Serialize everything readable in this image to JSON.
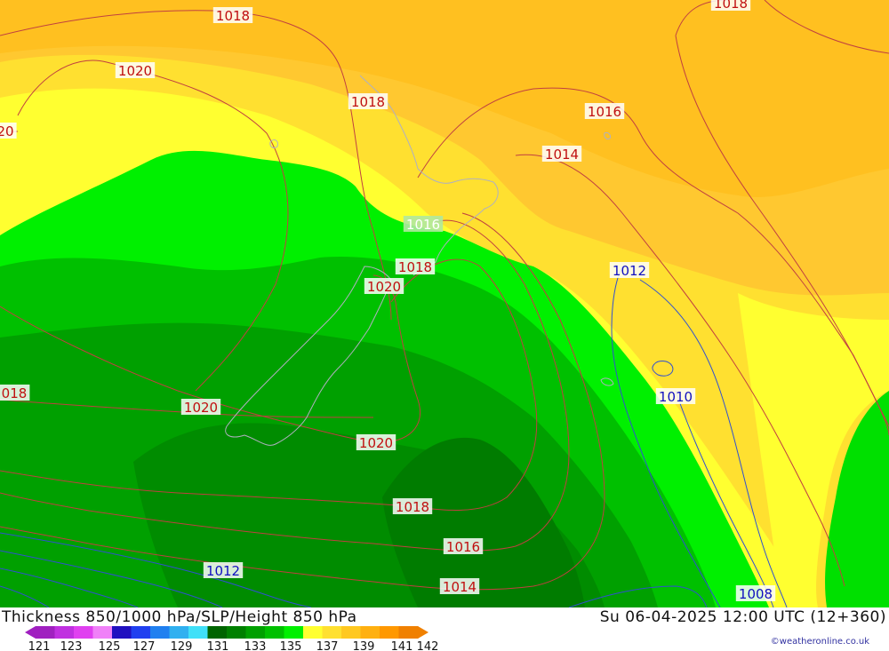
{
  "map": {
    "isobar_labels": [
      {
        "id": "l1",
        "text": "1018",
        "kind": "high"
      },
      {
        "id": "l2",
        "text": "1018",
        "kind": "high"
      },
      {
        "id": "l3",
        "text": "1020",
        "kind": "high"
      },
      {
        "id": "l4",
        "text": "20",
        "kind": "high"
      },
      {
        "id": "l5",
        "text": "1018",
        "kind": "high"
      },
      {
        "id": "l6",
        "text": "1016",
        "kind": "high"
      },
      {
        "id": "l7",
        "text": "1014",
        "kind": "high"
      },
      {
        "id": "l8",
        "text": "1016",
        "kind": "mid"
      },
      {
        "id": "l9",
        "text": "1018",
        "kind": "high"
      },
      {
        "id": "l10",
        "text": "1020",
        "kind": "high"
      },
      {
        "id": "l11",
        "text": "1012",
        "kind": "low"
      },
      {
        "id": "l12",
        "text": "1010",
        "kind": "low"
      },
      {
        "id": "l13",
        "text": "018",
        "kind": "high"
      },
      {
        "id": "l14",
        "text": "1020",
        "kind": "high"
      },
      {
        "id": "l15",
        "text": "1020",
        "kind": "high"
      },
      {
        "id": "l16",
        "text": "1018",
        "kind": "high"
      },
      {
        "id": "l17",
        "text": "1016",
        "kind": "high"
      },
      {
        "id": "l18",
        "text": "1014",
        "kind": "high"
      },
      {
        "id": "l19",
        "text": "1012",
        "kind": "low"
      },
      {
        "id": "l20",
        "text": "1008",
        "kind": "low"
      }
    ]
  },
  "footer": {
    "title": "Thickness 850/1000 hPa/SLP/Height 850 hPa",
    "datetime": "Su 06-04-2025 12:00 UTC (12+360)",
    "credit": "©weatheronline.co.uk"
  },
  "legend": {
    "ticks": [
      "121",
      "123",
      "125",
      "127",
      "129",
      "131",
      "133",
      "135",
      "137",
      "139",
      "141",
      "142"
    ],
    "colors": [
      "#a020c0",
      "#c030e0",
      "#e040f0",
      "#f080f8",
      "#2010c0",
      "#2040f0",
      "#2080f0",
      "#30b0f0",
      "#40e0f8",
      "#006400",
      "#008000",
      "#00a000",
      "#00c000",
      "#00f000",
      "#ffff30",
      "#ffe030",
      "#ffc820",
      "#ffb010",
      "#ff9800",
      "#f08000"
    ]
  },
  "colors": {
    "high_label_text": "#c01010",
    "low_label_text": "#1010c0",
    "mid_label_text": "#ffffff",
    "isobar_high": "#c04040",
    "isobar_low": "#3050d0",
    "coast": "#b0b0c0"
  }
}
